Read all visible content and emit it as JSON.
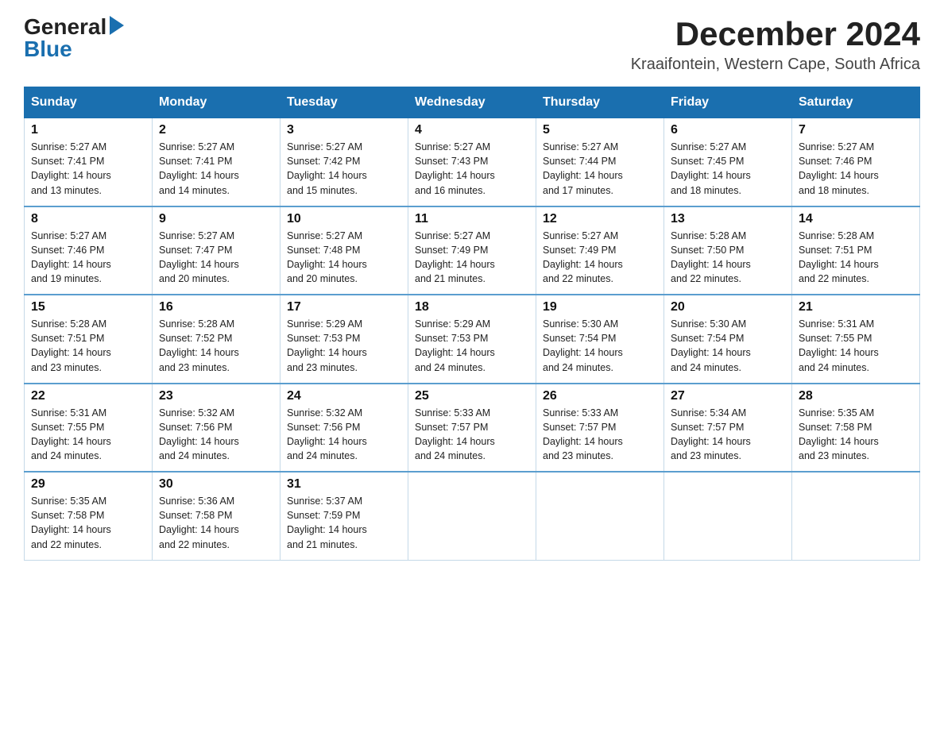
{
  "logo": {
    "general": "General",
    "blue": "Blue"
  },
  "header": {
    "month": "December 2024",
    "location": "Kraaifontein, Western Cape, South Africa"
  },
  "days_of_week": [
    "Sunday",
    "Monday",
    "Tuesday",
    "Wednesday",
    "Thursday",
    "Friday",
    "Saturday"
  ],
  "weeks": [
    [
      {
        "day": "1",
        "sunrise": "5:27 AM",
        "sunset": "7:41 PM",
        "daylight": "14 hours and 13 minutes."
      },
      {
        "day": "2",
        "sunrise": "5:27 AM",
        "sunset": "7:41 PM",
        "daylight": "14 hours and 14 minutes."
      },
      {
        "day": "3",
        "sunrise": "5:27 AM",
        "sunset": "7:42 PM",
        "daylight": "14 hours and 15 minutes."
      },
      {
        "day": "4",
        "sunrise": "5:27 AM",
        "sunset": "7:43 PM",
        "daylight": "14 hours and 16 minutes."
      },
      {
        "day": "5",
        "sunrise": "5:27 AM",
        "sunset": "7:44 PM",
        "daylight": "14 hours and 17 minutes."
      },
      {
        "day": "6",
        "sunrise": "5:27 AM",
        "sunset": "7:45 PM",
        "daylight": "14 hours and 18 minutes."
      },
      {
        "day": "7",
        "sunrise": "5:27 AM",
        "sunset": "7:46 PM",
        "daylight": "14 hours and 18 minutes."
      }
    ],
    [
      {
        "day": "8",
        "sunrise": "5:27 AM",
        "sunset": "7:46 PM",
        "daylight": "14 hours and 19 minutes."
      },
      {
        "day": "9",
        "sunrise": "5:27 AM",
        "sunset": "7:47 PM",
        "daylight": "14 hours and 20 minutes."
      },
      {
        "day": "10",
        "sunrise": "5:27 AM",
        "sunset": "7:48 PM",
        "daylight": "14 hours and 20 minutes."
      },
      {
        "day": "11",
        "sunrise": "5:27 AM",
        "sunset": "7:49 PM",
        "daylight": "14 hours and 21 minutes."
      },
      {
        "day": "12",
        "sunrise": "5:27 AM",
        "sunset": "7:49 PM",
        "daylight": "14 hours and 22 minutes."
      },
      {
        "day": "13",
        "sunrise": "5:28 AM",
        "sunset": "7:50 PM",
        "daylight": "14 hours and 22 minutes."
      },
      {
        "day": "14",
        "sunrise": "5:28 AM",
        "sunset": "7:51 PM",
        "daylight": "14 hours and 22 minutes."
      }
    ],
    [
      {
        "day": "15",
        "sunrise": "5:28 AM",
        "sunset": "7:51 PM",
        "daylight": "14 hours and 23 minutes."
      },
      {
        "day": "16",
        "sunrise": "5:28 AM",
        "sunset": "7:52 PM",
        "daylight": "14 hours and 23 minutes."
      },
      {
        "day": "17",
        "sunrise": "5:29 AM",
        "sunset": "7:53 PM",
        "daylight": "14 hours and 23 minutes."
      },
      {
        "day": "18",
        "sunrise": "5:29 AM",
        "sunset": "7:53 PM",
        "daylight": "14 hours and 24 minutes."
      },
      {
        "day": "19",
        "sunrise": "5:30 AM",
        "sunset": "7:54 PM",
        "daylight": "14 hours and 24 minutes."
      },
      {
        "day": "20",
        "sunrise": "5:30 AM",
        "sunset": "7:54 PM",
        "daylight": "14 hours and 24 minutes."
      },
      {
        "day": "21",
        "sunrise": "5:31 AM",
        "sunset": "7:55 PM",
        "daylight": "14 hours and 24 minutes."
      }
    ],
    [
      {
        "day": "22",
        "sunrise": "5:31 AM",
        "sunset": "7:55 PM",
        "daylight": "14 hours and 24 minutes."
      },
      {
        "day": "23",
        "sunrise": "5:32 AM",
        "sunset": "7:56 PM",
        "daylight": "14 hours and 24 minutes."
      },
      {
        "day": "24",
        "sunrise": "5:32 AM",
        "sunset": "7:56 PM",
        "daylight": "14 hours and 24 minutes."
      },
      {
        "day": "25",
        "sunrise": "5:33 AM",
        "sunset": "7:57 PM",
        "daylight": "14 hours and 24 minutes."
      },
      {
        "day": "26",
        "sunrise": "5:33 AM",
        "sunset": "7:57 PM",
        "daylight": "14 hours and 23 minutes."
      },
      {
        "day": "27",
        "sunrise": "5:34 AM",
        "sunset": "7:57 PM",
        "daylight": "14 hours and 23 minutes."
      },
      {
        "day": "28",
        "sunrise": "5:35 AM",
        "sunset": "7:58 PM",
        "daylight": "14 hours and 23 minutes."
      }
    ],
    [
      {
        "day": "29",
        "sunrise": "5:35 AM",
        "sunset": "7:58 PM",
        "daylight": "14 hours and 22 minutes."
      },
      {
        "day": "30",
        "sunrise": "5:36 AM",
        "sunset": "7:58 PM",
        "daylight": "14 hours and 22 minutes."
      },
      {
        "day": "31",
        "sunrise": "5:37 AM",
        "sunset": "7:59 PM",
        "daylight": "14 hours and 21 minutes."
      },
      null,
      null,
      null,
      null
    ]
  ],
  "labels": {
    "sunrise": "Sunrise:",
    "sunset": "Sunset:",
    "daylight": "Daylight:"
  }
}
